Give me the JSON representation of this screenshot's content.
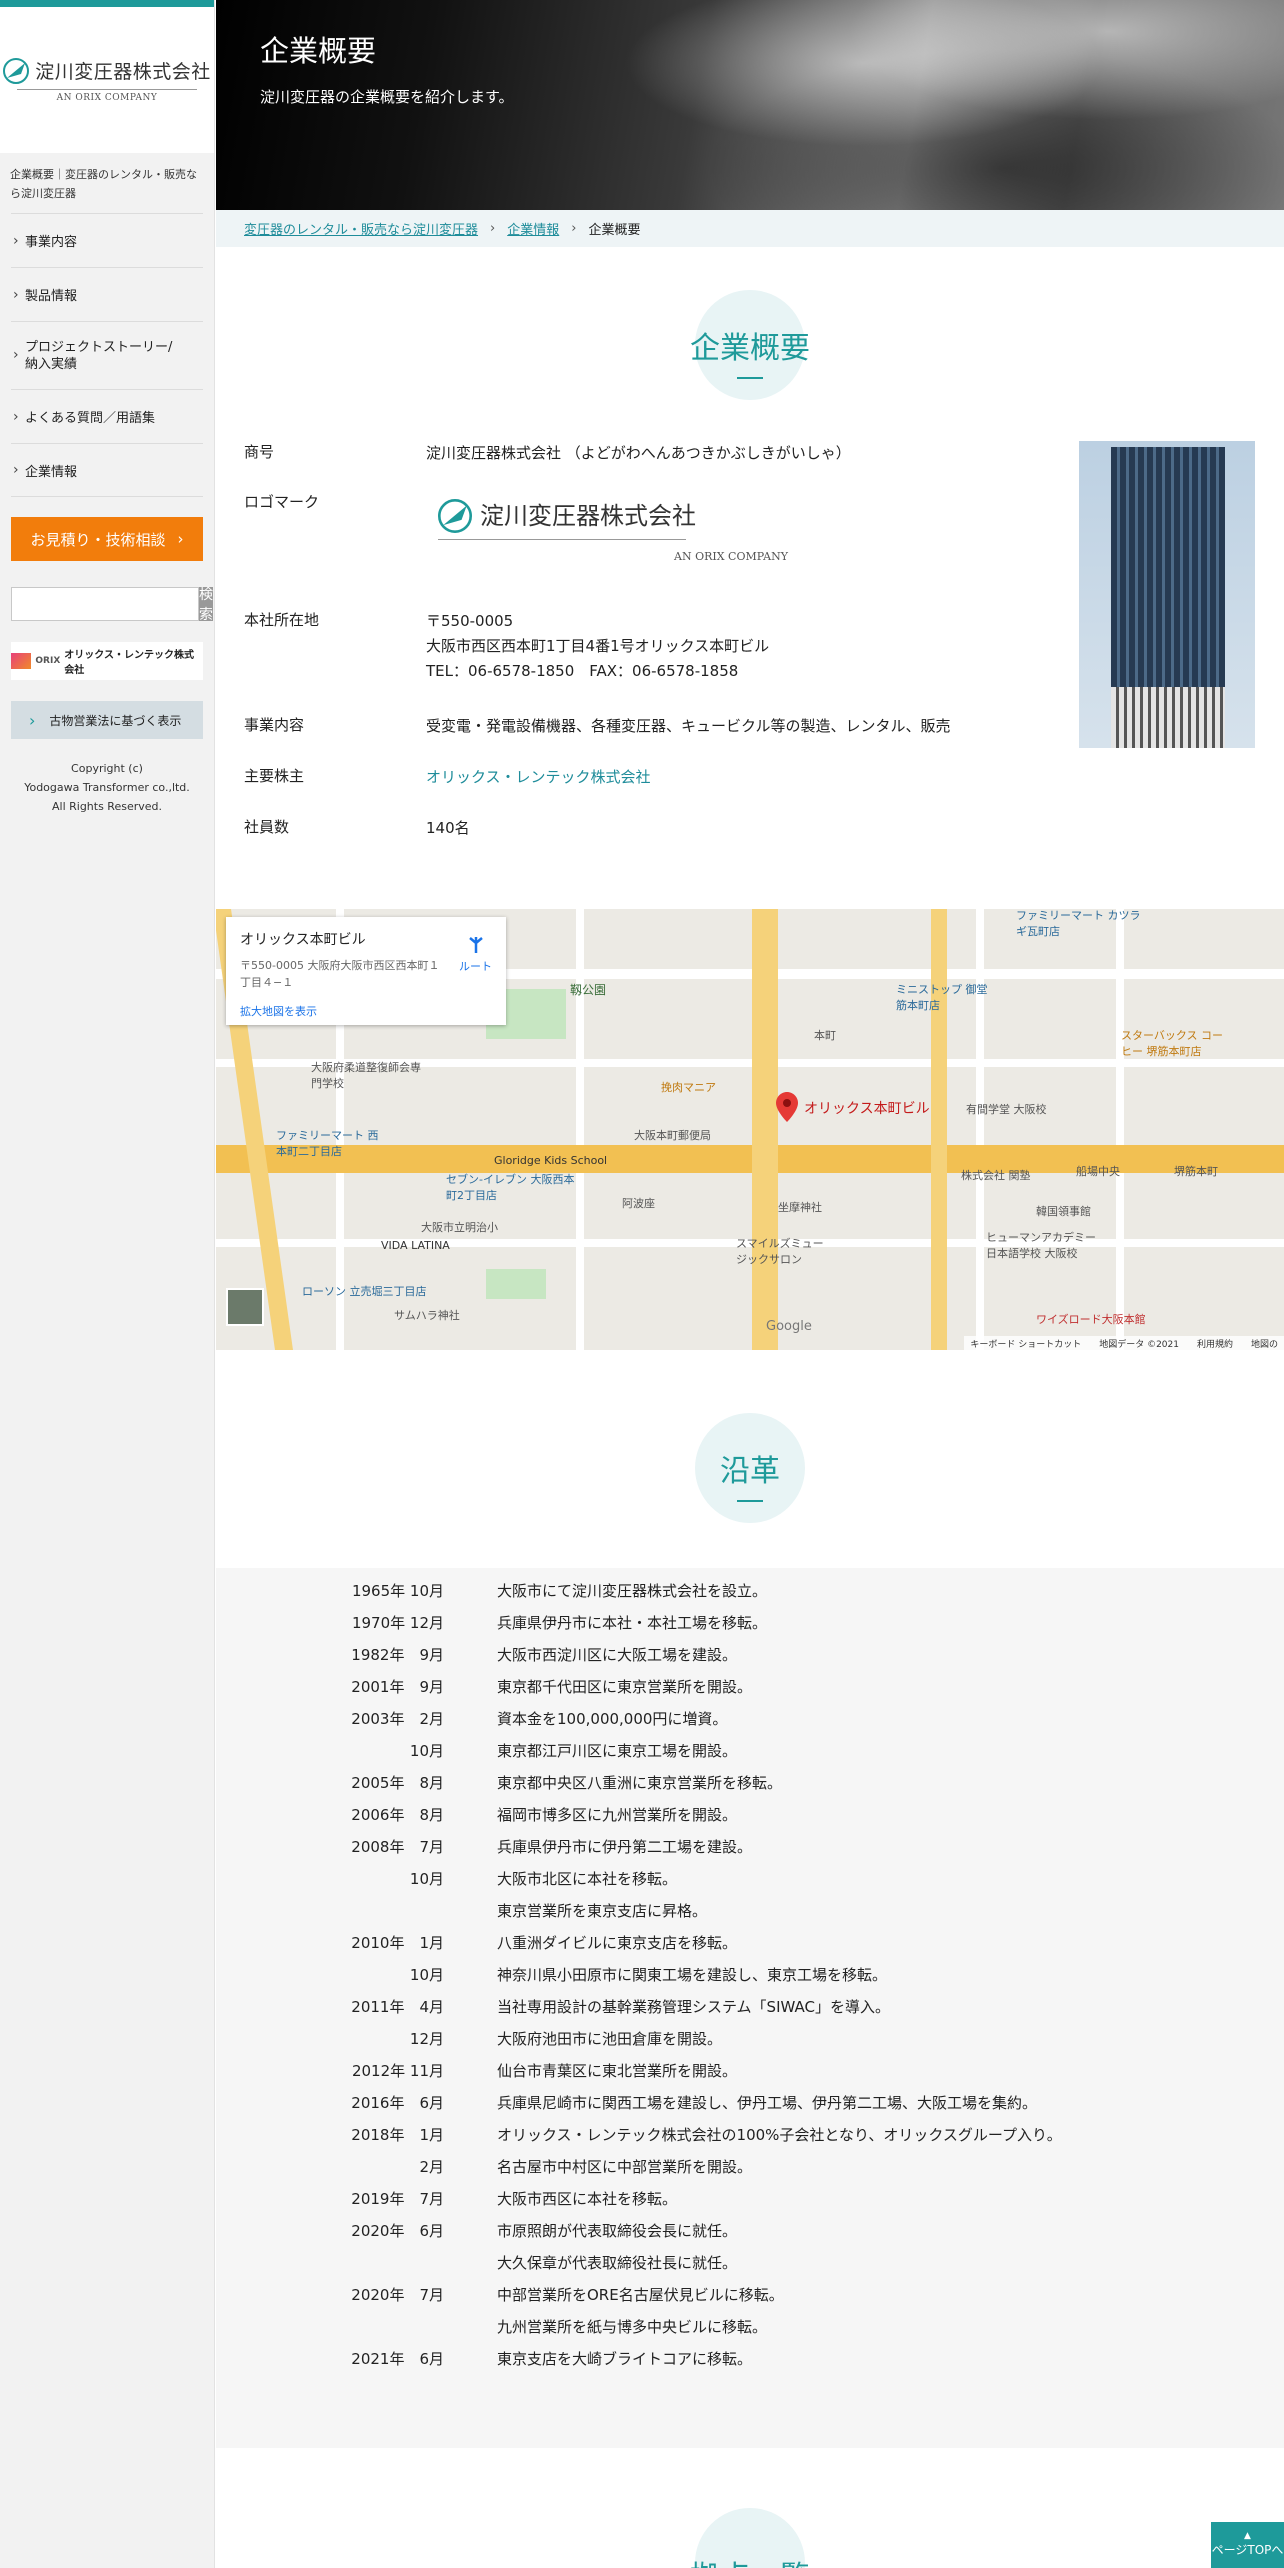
{
  "sidebar": {
    "logo_jp": "淀川変圧器株式会社",
    "logo_en": "AN ORIX COMPANY",
    "description": "企業概要｜変圧器のレンタル・販売なら淀川変圧器",
    "nav": [
      {
        "label": "事業内容"
      },
      {
        "label": "製品情報"
      },
      {
        "label": "プロジェクトストーリー/納入実績"
      },
      {
        "label": "よくある質問／用語集"
      },
      {
        "label": "企業情報"
      }
    ],
    "estimate_button": "お見積り・技術相談",
    "search_placeholder": "",
    "search_button": "検索",
    "orix_banner": "オリックス・レンテック株式会社",
    "orix_mark": "ORIX",
    "kobutsu": "古物営業法に基づく表示",
    "copyright": [
      "Copyright (c)",
      "Yodogawa Transformer co.,ltd.",
      "All Rights Reserved."
    ]
  },
  "hero": {
    "title": "企業概要",
    "subtitle": "淀川変圧器の企業概要を紹介します。"
  },
  "breadcrumb": [
    {
      "label": "変圧器のレンタル・販売なら淀川変圧器"
    },
    {
      "label": "企業情報"
    },
    {
      "label": "企業概要"
    }
  ],
  "breadcrumb_sep": "›",
  "overview": {
    "heading": "企業概要",
    "rows": {
      "name_k": "商号",
      "name_v": "淀川変圧器株式会社 （よどがわへんあつきかぶしきがいしゃ）",
      "logo_k": "ロゴマーク",
      "logo_jp": "淀川変圧器株式会社",
      "logo_en": "AN ORIX COMPANY",
      "hq_k": "本社所在地",
      "hq_zip": "〒550-0005",
      "hq_addr": "大阪市西区西本町1丁目4番1号オリックス本町ビル",
      "hq_tel": "TEL：06-6578-1850　FAX：06-6578-1858",
      "biz_k": "事業内容",
      "biz_v": "受変電・発電設備機器、各種変圧器、キュービクル等の製造、レンタル、販売",
      "share_k": "主要株主",
      "share_v": "オリックス・レンテック株式会社",
      "emp_k": "社員数",
      "emp_v": "140名"
    }
  },
  "map": {
    "card_title": "オリックス本町ビル",
    "card_addr": "〒550-0005 大阪府大阪市西区西本町１丁目４−１",
    "card_link": "拡大地図を表示",
    "route": "ルート",
    "pin_label": "オリックス本町ビル",
    "google": "Google",
    "footer": [
      "キーボード ショートカット",
      "地図データ ©2021",
      "利用規約",
      "地図の"
    ],
    "labels": [
      {
        "t": "靱公園"
      },
      {
        "t": "大阪本町郵便局"
      },
      {
        "t": "本町"
      },
      {
        "t": "阿波座"
      },
      {
        "t": "Gloridge Kids School"
      },
      {
        "t": "ファミリーマート 西本町二丁目店"
      },
      {
        "t": "セブン-イレブン 大阪西本町2丁目店"
      },
      {
        "t": "大阪市立明治小"
      },
      {
        "t": "VIDA LATINA"
      },
      {
        "t": "ローソン 立売堀三丁目店"
      },
      {
        "t": "サムハラ神社"
      },
      {
        "t": "坐摩神社"
      },
      {
        "t": "韓国領事館"
      },
      {
        "t": "ヒューマンアカデミー 日本語学校 大阪校"
      },
      {
        "t": "ワイズロード大阪本館"
      },
      {
        "t": "スターバックス コーヒー 堺筋本町店"
      },
      {
        "t": "ミニストップ 御堂筋本町店"
      },
      {
        "t": "挽肉マニア"
      },
      {
        "t": "ファミリーマート カツラギ瓦町店"
      },
      {
        "t": "有間学堂 大阪校"
      },
      {
        "t": "船場中央"
      },
      {
        "t": "堺筋本町"
      },
      {
        "t": "大阪府柔道整復師会専門学校"
      },
      {
        "t": "スマイルズミュージックサロン"
      },
      {
        "t": "株式会社 関塾"
      }
    ]
  },
  "history": {
    "heading": "沿革",
    "items": [
      {
        "y": "1965年 10月",
        "t": "大阪市にて淀川変圧器株式会社を設立。"
      },
      {
        "y": "1970年 12月",
        "t": "兵庫県伊丹市に本社・本社工場を移転。"
      },
      {
        "y": "1982年　9月",
        "t": "大阪市西淀川区に大阪工場を建設。"
      },
      {
        "y": "2001年　9月",
        "t": "東京都千代田区に東京営業所を開設。"
      },
      {
        "y": "2003年　2月",
        "t": "資本金を100,000,000円に増資。"
      },
      {
        "y": "10月",
        "t": "東京都江戸川区に東京工場を開設。"
      },
      {
        "y": "2005年　8月",
        "t": "東京都中央区八重洲に東京営業所を移転。"
      },
      {
        "y": "2006年　8月",
        "t": "福岡市博多区に九州営業所を開設。"
      },
      {
        "y": "2008年　7月",
        "t": "兵庫県伊丹市に伊丹第二工場を建設。"
      },
      {
        "y": "10月",
        "t": "大阪市北区に本社を移転。"
      },
      {
        "y": "",
        "t": "東京営業所を東京支店に昇格。"
      },
      {
        "y": "2010年　1月",
        "t": "八重洲ダイビルに東京支店を移転。"
      },
      {
        "y": "10月",
        "t": "神奈川県小田原市に関東工場を建設し、東京工場を移転。"
      },
      {
        "y": "2011年　4月",
        "t": "当社専用設計の基幹業務管理システム「SIWAC」を導入。"
      },
      {
        "y": "12月",
        "t": "大阪府池田市に池田倉庫を開設。"
      },
      {
        "y": "2012年 11月",
        "t": "仙台市青葉区に東北営業所を開設。"
      },
      {
        "y": "2016年　6月",
        "t": "兵庫県尼崎市に関西工場を建設し、伊丹工場、伊丹第二工場、大阪工場を集約。"
      },
      {
        "y": "2018年　1月",
        "t": "オリックス・レンテック株式会社の100%子会社となり、オリックスグループ入り。"
      },
      {
        "y": "2月",
        "t": "名古屋市中村区に中部営業所を開設。"
      },
      {
        "y": "2019年　7月",
        "t": "大阪市西区に本社を移転。"
      },
      {
        "y": "2020年　6月",
        "t": "市原照朗が代表取締役会長に就任。"
      },
      {
        "y": "",
        "t": "大久保章が代表取締役社長に就任。"
      },
      {
        "y": "2020年　7月",
        "t": "中部営業所をORE名古屋伏見ビルに移転。"
      },
      {
        "y": "",
        "t": "九州営業所を紙与博多中央ビルに移転。"
      },
      {
        "y": "2021年　6月",
        "t": "東京支店を大崎ブライトコアに移転。"
      }
    ]
  },
  "bases_heading": "拠点一覧",
  "pagetop": "ページTOPへ",
  "colors": {
    "accent": "#1e9a9a",
    "orange": "#f27d0c"
  }
}
